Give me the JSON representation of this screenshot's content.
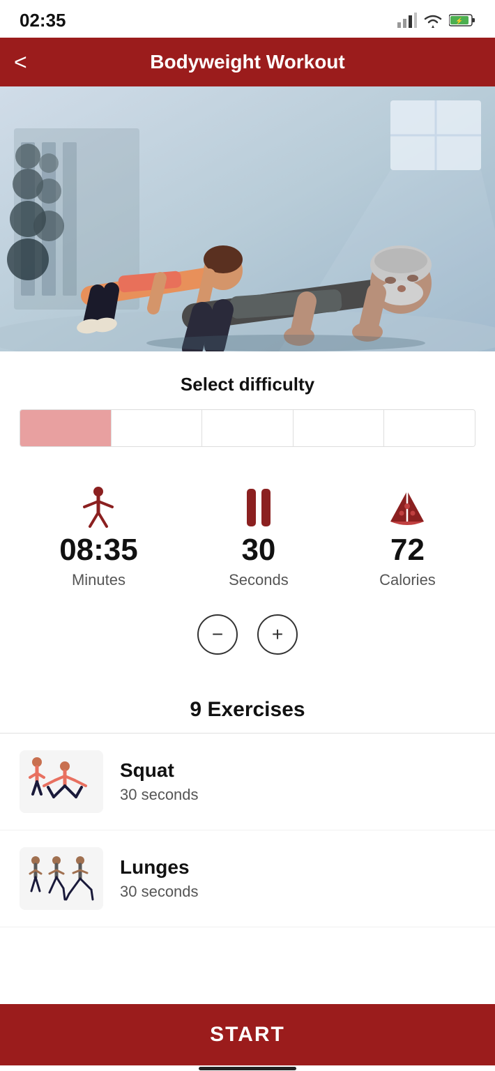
{
  "statusBar": {
    "time": "02:35",
    "icons": {
      "signal": "signal-icon",
      "wifi": "wifi-icon",
      "battery": "battery-icon"
    }
  },
  "header": {
    "title": "Bodyweight Workout",
    "backLabel": "<"
  },
  "difficulty": {
    "title": "Select difficulty",
    "segments": 5,
    "activeSegment": 0
  },
  "stats": {
    "minutes": {
      "value": "08:35",
      "label": "Minutes"
    },
    "seconds": {
      "value": "30",
      "label": "Seconds"
    },
    "calories": {
      "value": "72",
      "label": "Calories"
    }
  },
  "timerControls": {
    "minus": "−",
    "plus": "+"
  },
  "exercises": {
    "title": "9 Exercises",
    "items": [
      {
        "name": "Squat",
        "duration": "30 seconds"
      },
      {
        "name": "Lunges",
        "duration": "30 seconds"
      }
    ]
  },
  "startButton": "START",
  "colors": {
    "primary": "#9B1C1C",
    "iconRed": "#8B2020"
  }
}
